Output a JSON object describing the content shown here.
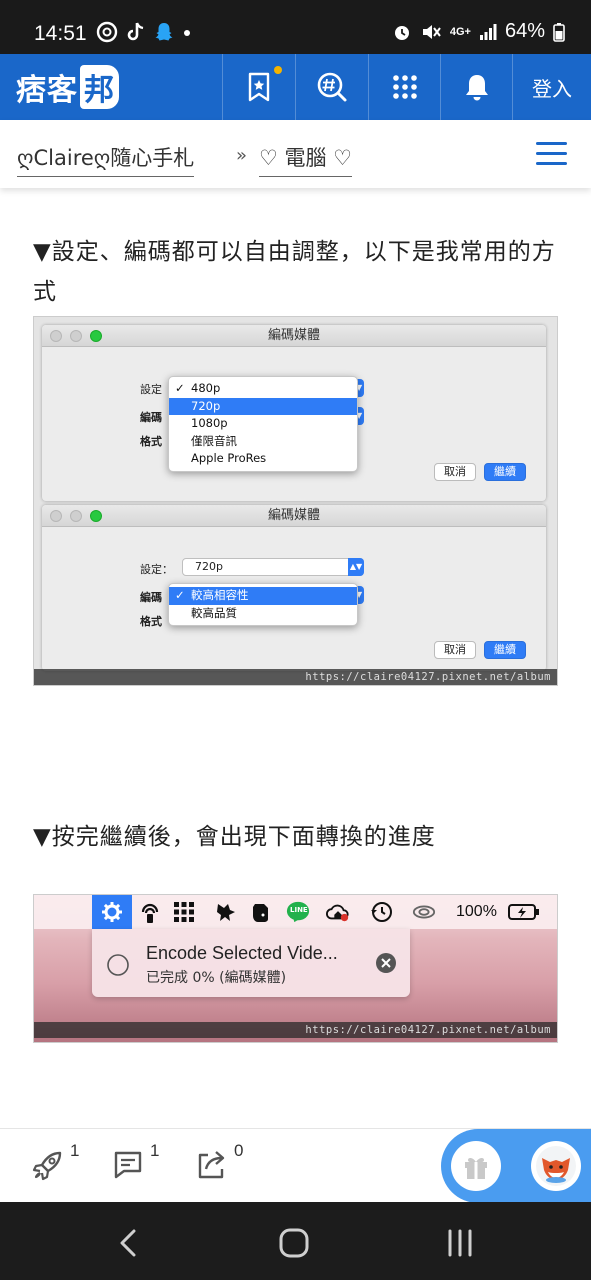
{
  "status_bar": {
    "time": "14:51",
    "network": "4G+",
    "battery": "64%"
  },
  "header": {
    "logo_text": "痞客",
    "logo_badge": "邦",
    "login_label": "登入"
  },
  "breadcrumb": {
    "blog_name": "ღClaireღ隨心手札",
    "separator": "»",
    "category": "♡ 電腦 ♡"
  },
  "article": {
    "para1": "▼設定、編碼都可以自由調整，以下是我常用的方式",
    "para2": "▼按完繼續後，會出現下面轉換的進度",
    "fig1": {
      "window_title": "編碼媒體",
      "label_setting": "設定",
      "label_encode": "編碼",
      "label_format": "格式",
      "resolution_options": [
        "480p",
        "720p",
        "1080p",
        "僅限音訊",
        "Apple ProRes"
      ],
      "selected_resolution": "720p",
      "checked_option": "480p",
      "cancel": "取消",
      "continue": "繼續",
      "label_setting_colon": "設定：",
      "encode_options": [
        "較高相容性",
        "較高品質"
      ],
      "watermark": "https://claire04127.pixnet.net/album"
    },
    "fig2": {
      "battery_text": "100%",
      "line_label": "LINE",
      "notif_title": "Encode Selected Vide...",
      "notif_subtitle": "已完成 0% (編碼媒體)",
      "watermark": "https://claire04127.pixnet.net/album"
    }
  },
  "actions": {
    "likes": "1",
    "comments": "1",
    "shares": "0"
  }
}
